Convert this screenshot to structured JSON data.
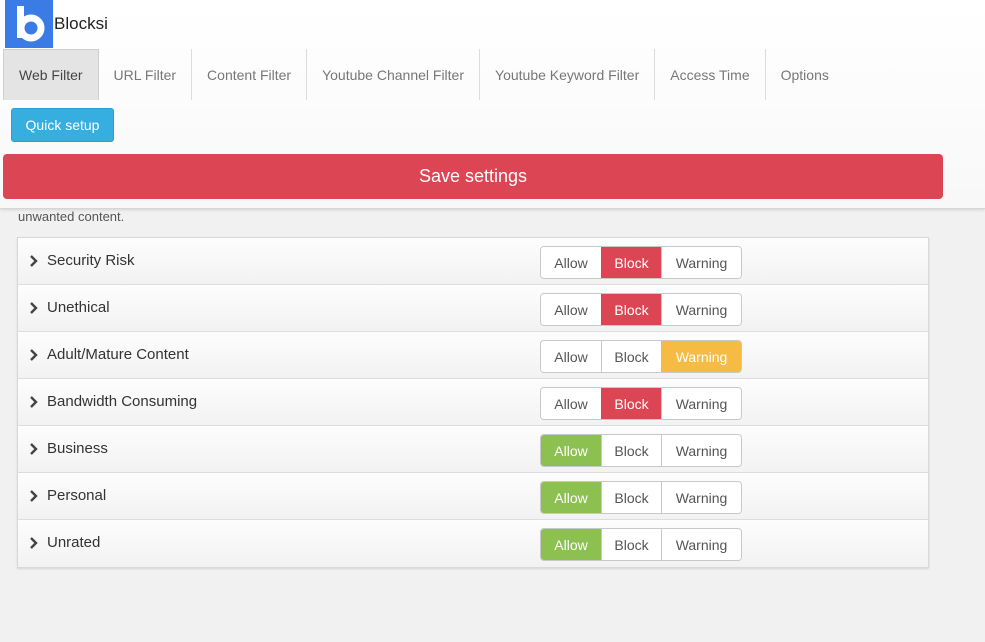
{
  "app": {
    "name": "Blocksi",
    "logo_letter": "b",
    "logo_color": "#3b7be6"
  },
  "tabs": [
    {
      "label": "Web Filter",
      "active": true
    },
    {
      "label": "URL Filter",
      "active": false
    },
    {
      "label": "Content Filter",
      "active": false
    },
    {
      "label": "Youtube Channel Filter",
      "active": false
    },
    {
      "label": "Youtube Keyword Filter",
      "active": false
    },
    {
      "label": "Access Time",
      "active": false
    },
    {
      "label": "Options",
      "active": false
    }
  ],
  "quick_setup_label": "Quick setup",
  "save_label": "Save settings",
  "description_tail": "unwanted content.",
  "option_labels": {
    "allow": "Allow",
    "block": "Block",
    "warning": "Warning"
  },
  "categories": [
    {
      "label": "Security Risk",
      "selected": "block"
    },
    {
      "label": "Unethical",
      "selected": "block"
    },
    {
      "label": "Adult/Mature Content",
      "selected": "warning"
    },
    {
      "label": "Bandwidth Consuming",
      "selected": "block"
    },
    {
      "label": "Business",
      "selected": "allow"
    },
    {
      "label": "Personal",
      "selected": "allow"
    },
    {
      "label": "Unrated",
      "selected": "allow"
    }
  ],
  "colors": {
    "accent_blue": "#36aee0",
    "save_red": "#dc4553",
    "block_red": "#dc4553",
    "allow_green": "#8cc152",
    "warning_yellow": "#f6bb42"
  }
}
